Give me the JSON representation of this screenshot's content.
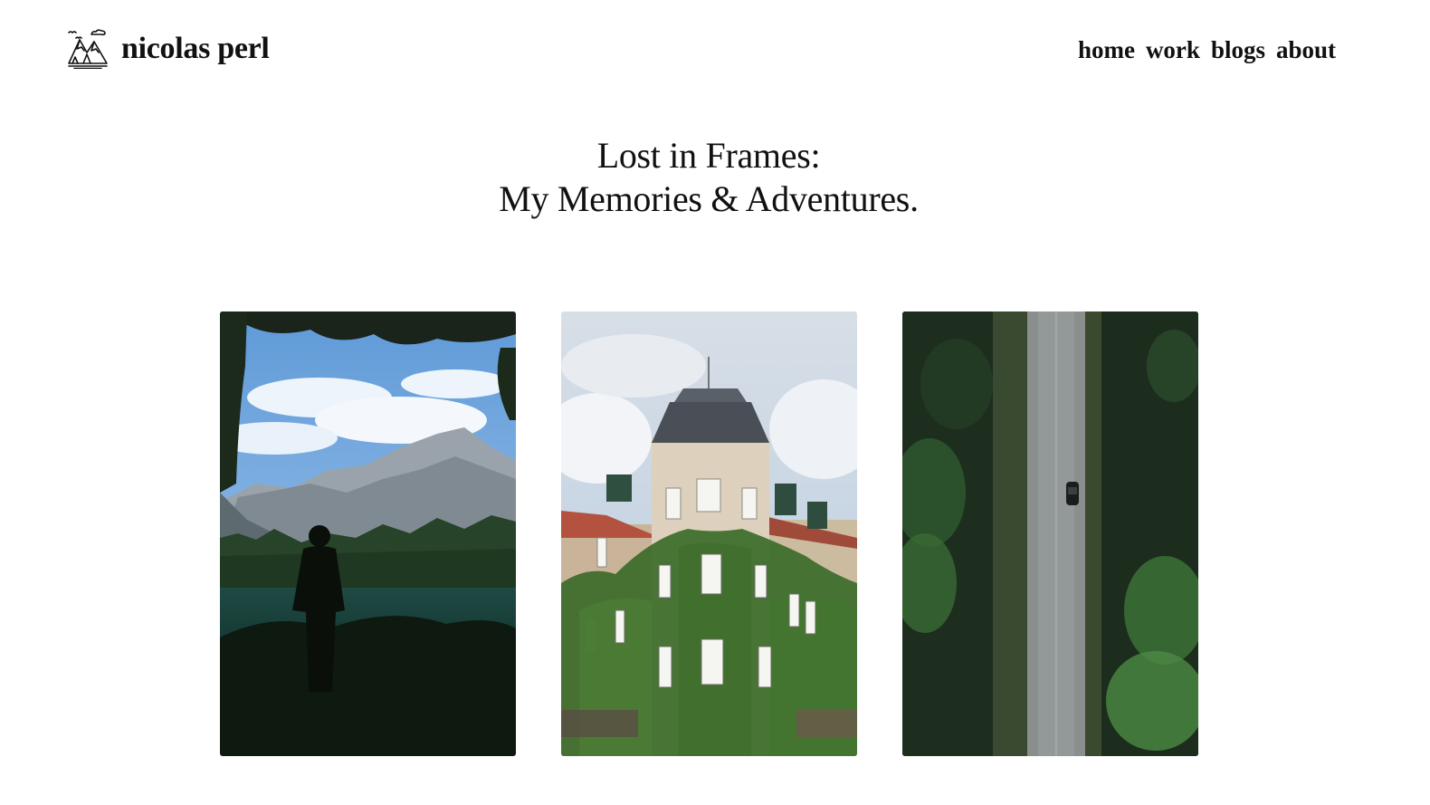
{
  "site": {
    "logo_icon": "mountain-logo-icon",
    "name": "nicolas perl"
  },
  "nav": {
    "items": [
      {
        "label": "home"
      },
      {
        "label": "work"
      },
      {
        "label": "blogs"
      },
      {
        "label": "about"
      }
    ]
  },
  "hero": {
    "line1": "Lost in Frames:",
    "line2": "My Memories & Adventures."
  },
  "gallery": {
    "photos": [
      {
        "icon": "mountain-lake-photo"
      },
      {
        "icon": "ivy-building-photo"
      },
      {
        "icon": "forest-road-photo"
      }
    ]
  },
  "colors": {
    "text": "#111111",
    "background": "#ffffff"
  }
}
